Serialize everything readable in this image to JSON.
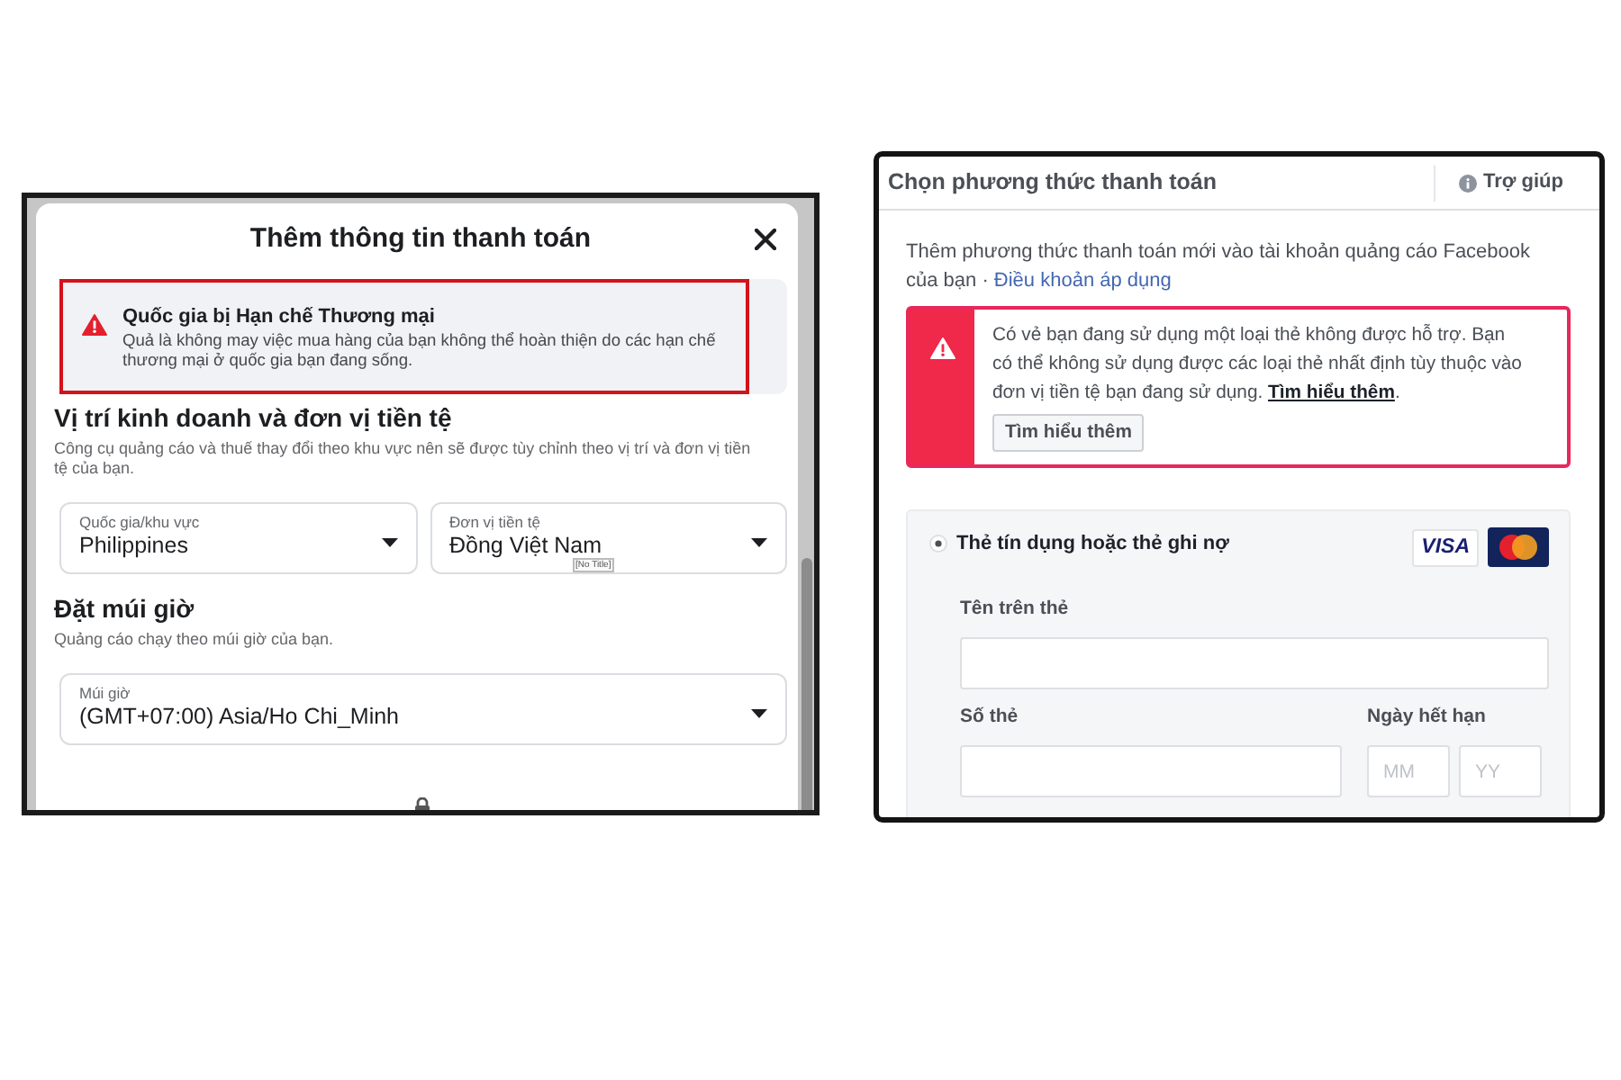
{
  "payment_info_dialog": {
    "title": "Thêm thông tin thanh toán",
    "alert": {
      "title": "Quốc gia bị Hạn chế Thương mại",
      "message": "Quả là không may việc mua hàng của bạn không thể hoàn thiện do các hạn chế thương mại ở quốc gia bạn đang sống."
    },
    "sections": [
      {
        "heading": "Vị trí kinh doanh và đơn vị tiền tệ",
        "description": "Công cụ quảng cáo và thuế thay đổi theo khu vực nên sẽ được tùy chỉnh theo vị trí và đơn vị tiền tệ của bạn.",
        "fields": [
          {
            "label": "Quốc gia/khu vực",
            "value": "Philippines"
          },
          {
            "label": "Đơn vị tiền tệ",
            "value": "Đồng Việt Nam",
            "tooltip": "[No Title]"
          }
        ]
      },
      {
        "heading": "Đặt múi giờ",
        "description": "Quảng cáo chạy theo múi giờ của bạn.",
        "fields": [
          {
            "label": "Múi giờ",
            "value": "(GMT+07:00) Asia/Ho Chi_Minh"
          }
        ]
      }
    ]
  },
  "payment_method_dialog": {
    "title": "Chọn phương thức thanh toán",
    "help": "Trợ giúp",
    "intro": "Thêm phương thức thanh toán mới vào tài khoản quảng cáo Facebook của bạn ·",
    "terms_link": "Điều khoản áp dụng",
    "alert": {
      "message": "Có vẻ bạn đang sử dụng một loại thẻ không được hỗ trợ. Bạn có thể không sử dụng được các loại thẻ nhất định tùy thuộc vào đơn vị tiền tệ bạn đang sử dụng.",
      "link": "Tìm hiểu thêm",
      "message_end": ".",
      "button": "Tìm hiểu thêm"
    },
    "card_option": {
      "label": "Thẻ tín dụng hoặc thẻ ghi nợ",
      "selected": true,
      "visa_logo": "VISA",
      "name_label": "Tên trên thẻ",
      "number_label": "Số thẻ",
      "expiry_label": "Ngày hết hạn",
      "expiry_month_placeholder": "MM",
      "expiry_year_placeholder": "YY"
    }
  }
}
